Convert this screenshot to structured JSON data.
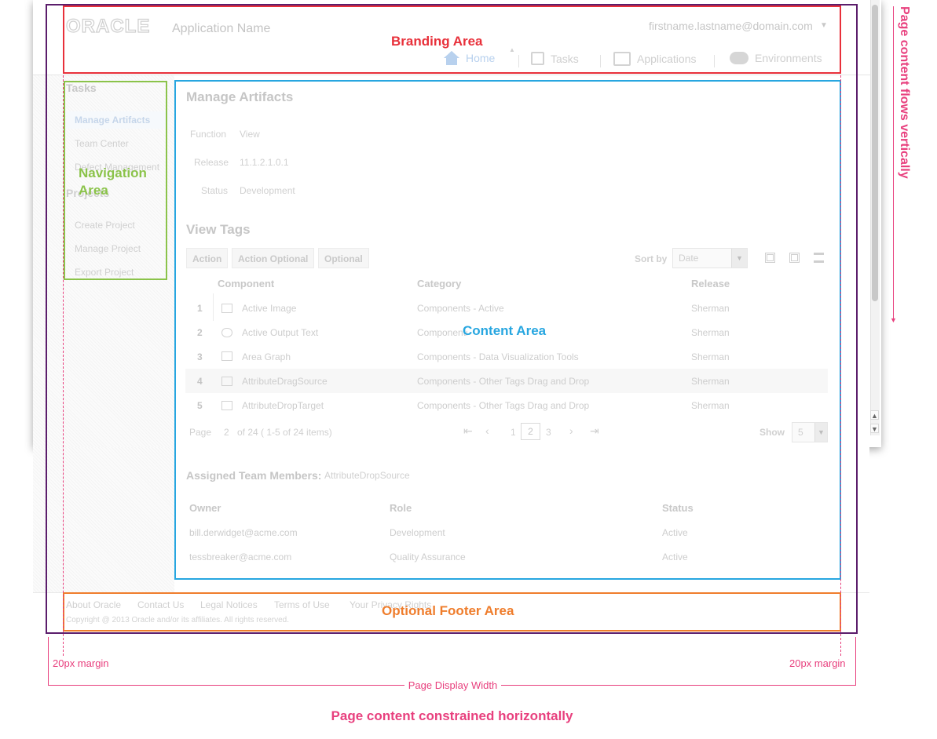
{
  "app": {
    "logo": "ORACLE",
    "application_name": "Application Name",
    "user_email": "firstname.lastname@domain.com",
    "nav": [
      {
        "label": "Home",
        "icon": "home-icon",
        "active": true
      },
      {
        "label": "Tasks",
        "icon": "checkbox-icon",
        "active": false
      },
      {
        "label": "Applications",
        "icon": "chart-icon",
        "active": false
      },
      {
        "label": "Environments",
        "icon": "cloud-icon",
        "active": false
      }
    ],
    "sidebar": {
      "tasks_title": "Tasks",
      "task_items": [
        "Manage Artifacts",
        "Team Center",
        "Defect Management"
      ],
      "projects_title": "Projects",
      "project_items": [
        "Create Project",
        "Manage Project",
        "Export Project"
      ]
    },
    "content": {
      "title": "Manage Artifacts",
      "fields": [
        {
          "label": "Function",
          "value": "View"
        },
        {
          "label": "Release",
          "value": "11.1.2.1.0.1"
        },
        {
          "label": "Status",
          "value": "Development"
        }
      ],
      "view_tags_title": "View Tags",
      "tag_buttons": [
        "Action",
        "Action Optional",
        "Optional"
      ],
      "sort_by_label": "Sort by",
      "sort_by_value": "Date",
      "table_headers": [
        "Component",
        "Category",
        "Release"
      ],
      "rows": [
        {
          "num": "1",
          "component": "Active Image",
          "category": "Components - Active",
          "release": "Sherman"
        },
        {
          "num": "2",
          "component": "Active Output Text",
          "category": "Components - Active",
          "release": "Sherman"
        },
        {
          "num": "3",
          "component": "Area Graph",
          "category": "Components - Data Visualization Tools",
          "release": "Sherman"
        },
        {
          "num": "4",
          "component": "AttributeDragSource",
          "category": "Components - Other Tags Drag and Drop",
          "release": "Sherman"
        },
        {
          "num": "5",
          "component": "AttributeDropTarget",
          "category": "Components - Other Tags Drag and Drop",
          "release": "Sherman"
        }
      ],
      "pagination": {
        "page_label": "Page",
        "page_value": "2",
        "of_text": "of 24 ( 1-5 of 24 items)",
        "pages": [
          "1",
          "2",
          "3"
        ],
        "show_label": "Show",
        "show_value": "5"
      },
      "assigned_title": "Assigned Team Members:",
      "assigned_subtitle": "AttributeDropSource",
      "team_headers": [
        "Owner",
        "Role",
        "Status"
      ],
      "team_rows": [
        {
          "owner": "bill.derwidget@acme.com",
          "role": "Development",
          "status": "Active"
        },
        {
          "owner": "tessbreaker@acme.com",
          "role": "Quality Assurance",
          "status": "Active"
        }
      ]
    },
    "footer": {
      "links": [
        "About Oracle",
        "Contact Us",
        "Legal Notices",
        "Terms of Use",
        "Your Privacy Rights"
      ],
      "copyright": "Copyright @ 2013 Oracle and/or its affiliates. All rights reserved."
    }
  },
  "annotations": {
    "branding_area": "Branding Area",
    "navigation_area": "Navigation Area",
    "content_area": "Content Area",
    "footer_area": "Optional Footer Area",
    "left_margin": "20px margin",
    "right_margin": "20px margin",
    "page_display_width": "Page Display Width",
    "vertical_flow": "Page content flows vertically",
    "horizontal_constraint": "Page content constrained horizontally"
  },
  "colors": {
    "branding": "#e8303a",
    "navigation": "#8bc34a",
    "content": "#27a6e0",
    "footer": "#ef7d2c",
    "page_frame": "#5b1d6b",
    "measure": "#e8407e"
  }
}
